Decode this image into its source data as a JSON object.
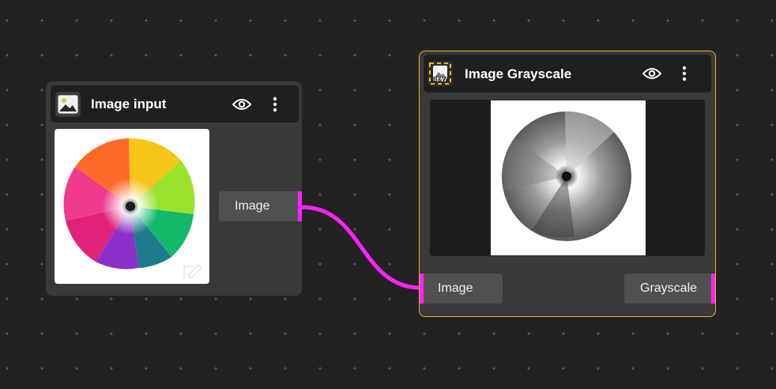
{
  "colors": {
    "background": "#222222",
    "node": "#393939",
    "node_header": "#1f1f1f",
    "port": "#505050",
    "connection": "#ff22ff",
    "selected_outline": "#e6b422"
  },
  "nodes": {
    "image_input": {
      "title": "Image input",
      "icon": "image-icon",
      "output_label": "Image",
      "visibility_icon": "eye-icon",
      "menu_icon": "vertical-dots-icon",
      "edit_icon": "pencil-icon"
    },
    "image_grayscale": {
      "title": "Image Grayscale",
      "icon": "b-and-w-filter-icon",
      "icon_text": "B&W",
      "selected": true,
      "input_label": "Image",
      "output_label": "Grayscale",
      "visibility_icon": "eye-icon",
      "menu_icon": "vertical-dots-icon"
    }
  }
}
